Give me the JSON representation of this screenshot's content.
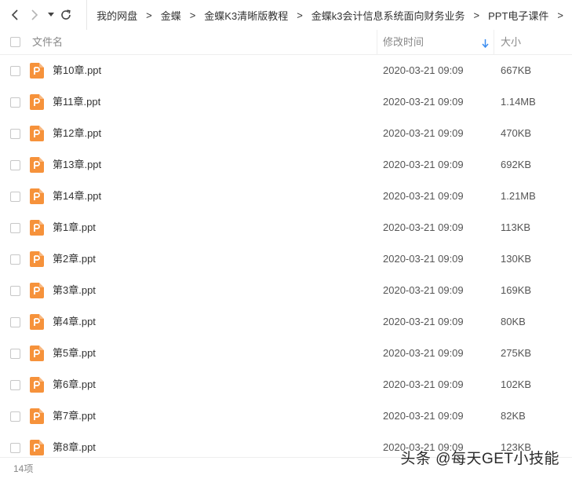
{
  "breadcrumb": [
    "我的网盘",
    "金蝶",
    "金蝶K3清晰版教程",
    "金蝶k3会计信息系统面向财务业务",
    "PPT电子课件"
  ],
  "breadcrumb_separator": ">",
  "icons": {
    "back": "chevron-left-icon",
    "forward": "chevron-right-icon",
    "history": "caret-down-icon",
    "refresh": "refresh-icon",
    "file": "ppt-file-icon",
    "sort": "sort-down-arrow-icon"
  },
  "colors": {
    "ppt_icon": "#F6923B",
    "sort_arrow": "#3B8DF0",
    "border": "#EEEEEE"
  },
  "columns": {
    "name": "文件名",
    "modified": "修改时间",
    "size": "大小"
  },
  "files": [
    {
      "name": "第10章.ppt",
      "date": "2020-03-21 09:09",
      "size": "667KB"
    },
    {
      "name": "第11章.ppt",
      "date": "2020-03-21 09:09",
      "size": "1.14MB"
    },
    {
      "name": "第12章.ppt",
      "date": "2020-03-21 09:09",
      "size": "470KB"
    },
    {
      "name": "第13章.ppt",
      "date": "2020-03-21 09:09",
      "size": "692KB"
    },
    {
      "name": "第14章.ppt",
      "date": "2020-03-21 09:09",
      "size": "1.21MB"
    },
    {
      "name": "第1章.ppt",
      "date": "2020-03-21 09:09",
      "size": "113KB"
    },
    {
      "name": "第2章.ppt",
      "date": "2020-03-21 09:09",
      "size": "130KB"
    },
    {
      "name": "第3章.ppt",
      "date": "2020-03-21 09:09",
      "size": "169KB"
    },
    {
      "name": "第4章.ppt",
      "date": "2020-03-21 09:09",
      "size": "80KB"
    },
    {
      "name": "第5章.ppt",
      "date": "2020-03-21 09:09",
      "size": "275KB"
    },
    {
      "name": "第6章.ppt",
      "date": "2020-03-21 09:09",
      "size": "102KB"
    },
    {
      "name": "第7章.ppt",
      "date": "2020-03-21 09:09",
      "size": "82KB"
    },
    {
      "name": "第8章.ppt",
      "date": "2020-03-21 09:09",
      "size": "123KB"
    }
  ],
  "footer": {
    "count": "14项",
    "watermark": "头条 @每天GET小技能"
  }
}
